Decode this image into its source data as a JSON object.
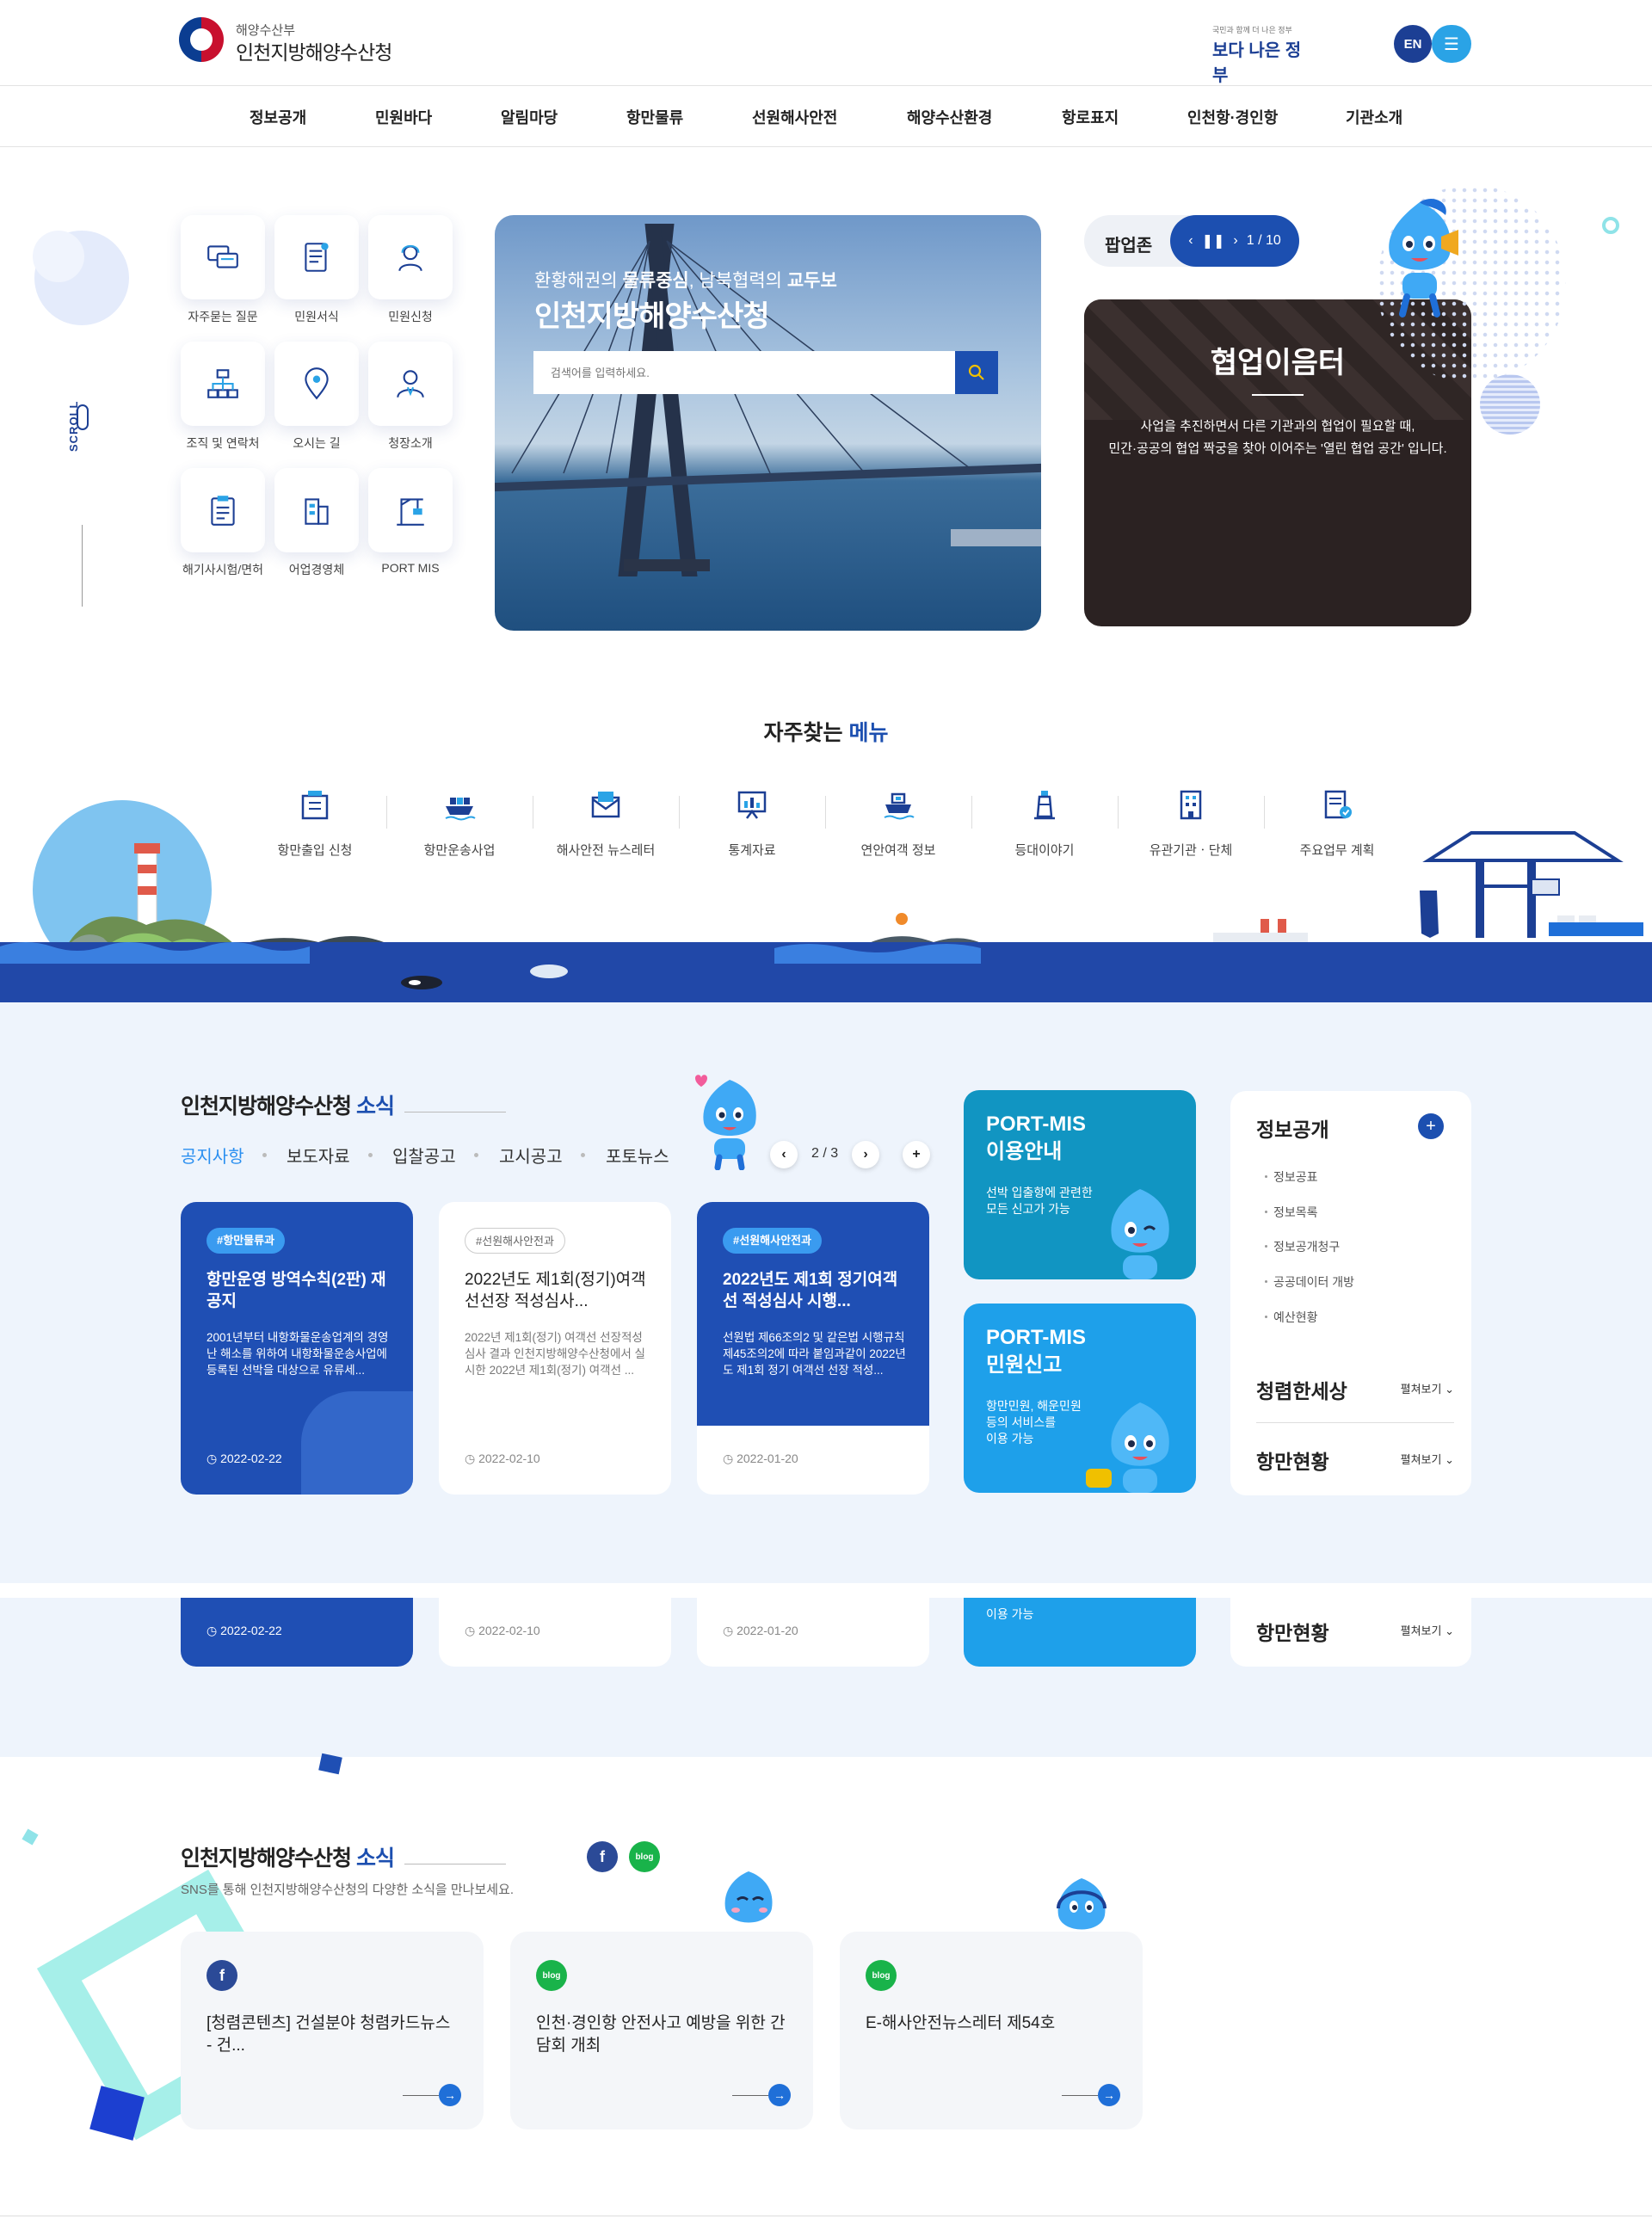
{
  "header": {
    "org_sub": "해양수산부",
    "org_name": "인천지방해양수산청",
    "better_gov_small": "국민과 함께 더 나은 정부",
    "better_gov_label": "보다 나은 정부",
    "lang_label": "EN"
  },
  "nav": {
    "items": [
      "정보공개",
      "민원바다",
      "알림마당",
      "항만물류",
      "선원해사안전",
      "해양수산환경",
      "항로표지",
      "인천항·경인항",
      "기관소개"
    ]
  },
  "quick_menu": [
    {
      "label": "자주묻는 질문",
      "icon": "chat-icon"
    },
    {
      "label": "민원서식",
      "icon": "document-icon"
    },
    {
      "label": "민원신청",
      "icon": "person-headset-icon"
    },
    {
      "label": "조직 및 연락처",
      "icon": "org-chart-icon"
    },
    {
      "label": "오시는 길",
      "icon": "map-pin-icon"
    },
    {
      "label": "청장소개",
      "icon": "person-icon"
    },
    {
      "label": "해기사시험/면허",
      "icon": "clipboard-icon"
    },
    {
      "label": "어업경영체",
      "icon": "building-icon"
    },
    {
      "label": "PORT MIS",
      "icon": "crane-icon"
    }
  ],
  "scroll_label": "SCROLL",
  "hero": {
    "subtitle_pre": "환황해권의 ",
    "subtitle_b1": "물류중심",
    "subtitle_mid": ", 남북협력의 ",
    "subtitle_b2": "교두보",
    "title": "인천지방해양수산청",
    "search_placeholder": "검색어를 입력하세요."
  },
  "popup": {
    "label": "팝업존",
    "counter": "1 / 10",
    "card_title": "협업이음터",
    "card_desc_1": "사업을 추진하면서 다른 기관과의 협업이 필요할 때,",
    "card_desc_2": "민간·공공의 협업 짝궁을 찾아 이어주는 '열린 협업 공간' 입니다."
  },
  "freq": {
    "title_pre": "자주찾는",
    "title_acc": "메뉴",
    "items": [
      {
        "label": "항만출입 신청",
        "icon": "gate-icon"
      },
      {
        "label": "항만운송사업",
        "icon": "cargo-ship-icon"
      },
      {
        "label": "해사안전 뉴스레터",
        "icon": "mail-icon"
      },
      {
        "label": "통계자료",
        "icon": "chart-board-icon"
      },
      {
        "label": "연안여객 정보",
        "icon": "ferry-icon"
      },
      {
        "label": "등대이야기",
        "icon": "lighthouse-icon"
      },
      {
        "label": "유관기관ㆍ단체",
        "icon": "office-building-icon"
      },
      {
        "label": "주요업무 계획",
        "icon": "plan-doc-icon"
      }
    ]
  },
  "news": {
    "title_pre": "인천지방해양수산청",
    "title_acc": "소식",
    "tabs": [
      "공지사항",
      "보도자료",
      "입찰공고",
      "고시공고",
      "포토뉴스"
    ],
    "pager": "2 / 3",
    "cards": [
      {
        "tag": "#항만물류과",
        "title": "항만운영 방역수칙(2판) 재공지",
        "desc": "2001년부터 내항화물운송업계의 경영난 해소를 위하여 내항화물운송사업에 등록된 선박을 대상으로 유류세...",
        "date": "2022-02-22"
      },
      {
        "tag": "#선원해사안전과",
        "title": "2022년도 제1회(정기)여객선선장 적성심사...",
        "desc": "2022년 제1회(정기) 여객선 선장적성심사 결과 인천지방해양수산청에서 실시한 2022년 제1회(정기) 여객선 ...",
        "date": "2022-02-10"
      },
      {
        "tag": "#선원해사안전과",
        "title": "2022년도 제1회 정기여객선 적성심사 시행...",
        "desc": "선원법 제66조의2 및 같은법 시행규칙 제45조의2에 따라 붙임과같이 2022년도 제1회 정기 여객선 선장 적성...",
        "date": "2022-01-20"
      }
    ],
    "port_cards": [
      {
        "title1": "PORT-MIS",
        "title2": "이용안내",
        "desc1": "선박 입출항에 관련한",
        "desc2": "모든 신고가 가능",
        "color": "#1195c2"
      },
      {
        "title1": "PORT-MIS",
        "title2": "민원신고",
        "desc1": "항만민원, 해운민원",
        "desc2": "등의 서비스를",
        "desc3": "이용 가능",
        "color": "#1ea0ea"
      }
    ],
    "dup_desc_frag": "이용 가능",
    "info": {
      "title": "정보공개",
      "links": [
        "정보공표",
        "정보목록",
        "정보공개청구",
        "공공데이터 개방",
        "예산현황"
      ],
      "rows": [
        {
          "title": "청렴한세상",
          "more": "펼쳐보기"
        },
        {
          "title": "항만현황",
          "more": "펼쳐보기"
        }
      ]
    }
  },
  "sns": {
    "title_pre": "인천지방해양수산청",
    "title_acc": "소식",
    "desc": "SNS를 통해 인천지방해양수산청의 다양한 소식을 만나보세요.",
    "fb_label": "f",
    "blog_label": "blog",
    "cards": [
      {
        "type": "f",
        "text": "[청렴콘텐츠] 건설분야 청렴카드뉴스 - 건..."
      },
      {
        "type": "blog",
        "text": "인천·경인항 안전사고 예방을 위한 간담회 개최"
      },
      {
        "type": "blog",
        "text": "E-해사안전뉴스레터 제54호"
      }
    ]
  },
  "colors": {
    "primary": "#1c4fb0",
    "sea": "#2148a8",
    "accent": "#2a8ff0",
    "popup_bg": "#2b2222"
  }
}
